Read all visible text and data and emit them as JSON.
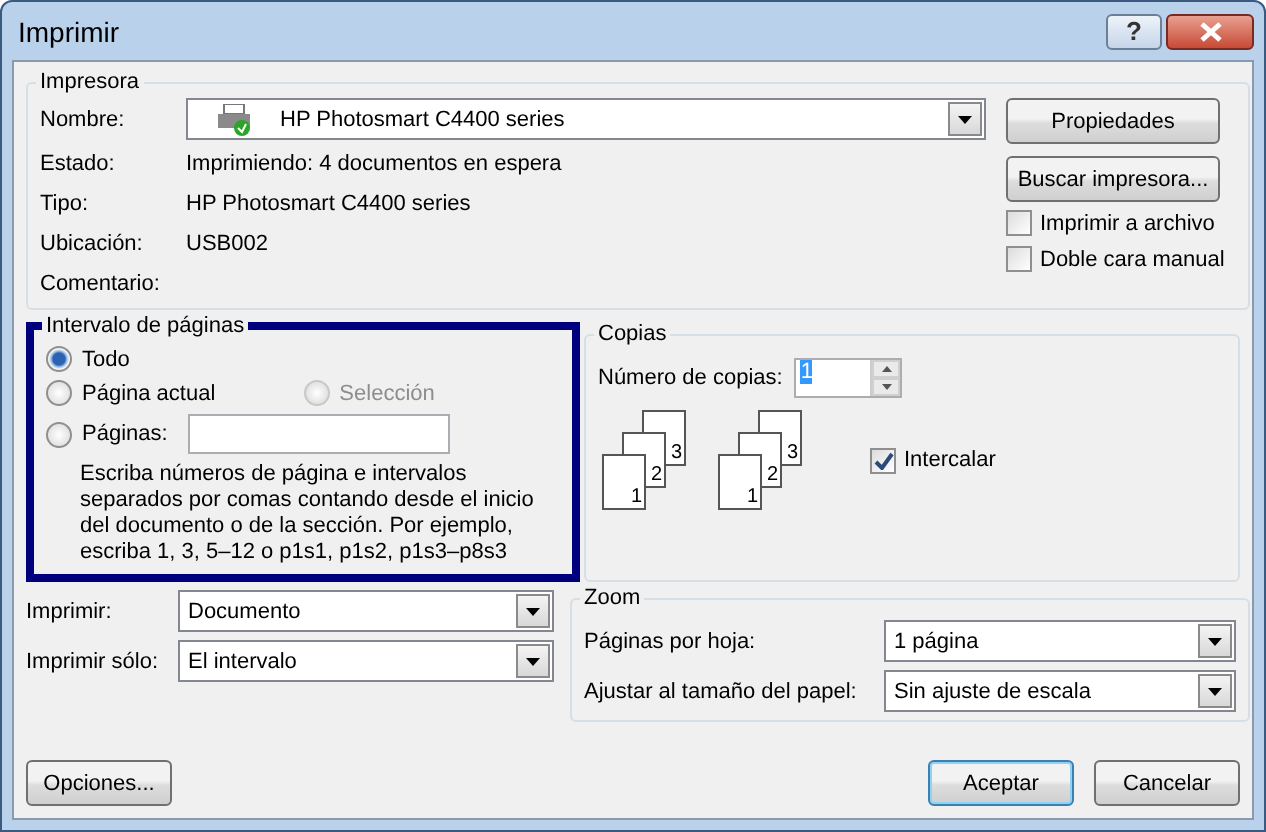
{
  "window": {
    "title": "Imprimir",
    "help": "?"
  },
  "printer": {
    "title": "Impresora",
    "name_label": "Nombre:",
    "name_value": "HP Photosmart C4400 series",
    "fields": [
      {
        "label": "Estado:",
        "value": "Imprimiendo: 4 documentos en espera"
      },
      {
        "label": "Tipo:",
        "value": "HP Photosmart C4400 series"
      },
      {
        "label": "Ubicación:",
        "value": "USB002"
      },
      {
        "label": "Comentario:"
      }
    ],
    "buttons": [
      "Propiedades",
      "Buscar impresora..."
    ],
    "checkboxes": [
      {
        "label": "Imprimir a archivo",
        "checked": false
      },
      {
        "label": "Doble cara manual",
        "checked": false
      }
    ]
  },
  "page_range": {
    "title": "Intervalo de páginas",
    "highlighted": true,
    "options": [
      {
        "label": "Todo",
        "selected": true,
        "disabled": false
      },
      {
        "label": "Página actual",
        "selected": false,
        "disabled": false
      },
      {
        "label": "Selección",
        "selected": false,
        "disabled": true
      },
      {
        "label": "Páginas:",
        "selected": false,
        "disabled": false
      }
    ],
    "hint": "Escriba números de página e intervalos separados por comas contando desde el inicio del documento o de la sección. Por ejemplo, escriba 1, 3, 5–12 o p1s1, p1s2, p1s3–p8s3"
  },
  "copies": {
    "title": "Copias",
    "label": "Número de copias:",
    "value": "1",
    "stacks": [
      [
        "3",
        "2",
        "1"
      ],
      [
        "3",
        "2",
        "1"
      ]
    ],
    "collate": {
      "label": "Intercalar",
      "checked": true
    }
  },
  "print_options": [
    {
      "label": "Imprimir:",
      "value": "Documento"
    },
    {
      "label": "Imprimir sólo:",
      "value": "El intervalo"
    }
  ],
  "zoom": {
    "title": "Zoom",
    "rows": [
      {
        "label": "Páginas por hoja:",
        "value": "1 página"
      },
      {
        "label": "Ajustar al tamaño del papel:",
        "value": "Sin ajuste de escala"
      }
    ]
  },
  "footer": {
    "options_button": "Opciones...",
    "buttons": [
      {
        "label": "Aceptar",
        "default": true
      },
      {
        "label": "Cancelar",
        "default": false
      }
    ]
  }
}
